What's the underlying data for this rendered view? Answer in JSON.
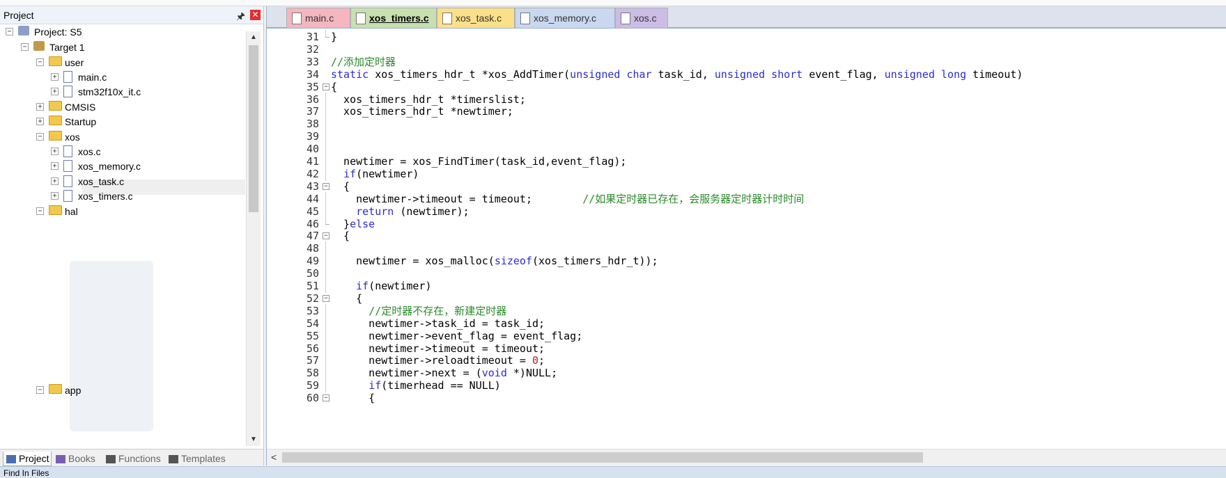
{
  "project_panel": {
    "title": "Project",
    "pin_icon": "pin-icon",
    "close_glyph": "✕",
    "tree": [
      {
        "label": "Project: S5",
        "icon": "project-icon",
        "expander": "−",
        "level": 0
      },
      {
        "label": "Target 1",
        "icon": "target-icon",
        "expander": "−",
        "level": 1
      },
      {
        "label": "user",
        "icon": "folder-icon",
        "expander": "−",
        "level": 2
      },
      {
        "label": "main.c",
        "icon": "file-icon",
        "expander": "+",
        "level": 3
      },
      {
        "label": "stm32f10x_it.c",
        "icon": "file-icon",
        "expander": "+",
        "level": 3
      },
      {
        "label": "CMSIS",
        "icon": "folder-icon",
        "expander": "+",
        "level": 2
      },
      {
        "label": "Startup",
        "icon": "folder-icon",
        "expander": "+",
        "level": 2
      },
      {
        "label": "xos",
        "icon": "folder-icon",
        "expander": "−",
        "level": 2
      },
      {
        "label": "xos.c",
        "icon": "file-icon",
        "expander": "+",
        "level": 3,
        "selected": true
      },
      {
        "label": "xos_memory.c",
        "icon": "file-icon",
        "expander": "+",
        "level": 3
      },
      {
        "label": "xos_task.c",
        "icon": "file-icon",
        "expander": "+",
        "level": 3
      },
      {
        "label": "xos_timers.c",
        "icon": "file-icon",
        "expander": "+",
        "level": 3
      },
      {
        "label": "hal",
        "icon": "folder-icon",
        "expander": "−",
        "level": 2
      },
      {
        "label": "app",
        "icon": "folder-icon",
        "expander": "−",
        "level": 2
      }
    ],
    "bottom_tabs": [
      {
        "label": "Project",
        "icon": "project-tab-icon",
        "active": true
      },
      {
        "label": "Books",
        "icon": "books-icon",
        "active": false
      },
      {
        "label": "Functions",
        "icon": "functions-icon",
        "active": false
      },
      {
        "label": "Templates",
        "icon": "templates-icon",
        "active": false
      }
    ]
  },
  "editor": {
    "tabs": [
      {
        "label": "main.c",
        "color": "#f4b6bf",
        "active": false
      },
      {
        "label": "xos_timers.c",
        "color": "#c8e0b0",
        "active": true
      },
      {
        "label": "xos_task.c",
        "color": "#fbe08a",
        "active": false
      },
      {
        "label": "xos_memory.c",
        "color": "#c9d8f0",
        "active": false
      },
      {
        "label": "xos.c",
        "color": "#cbbde6",
        "active": false
      }
    ],
    "lines": [
      {
        "n": "31",
        "fold": "end",
        "segs": [
          [
            "}",
            ""
          ]
        ]
      },
      {
        "n": "32",
        "fold": "",
        "segs": []
      },
      {
        "n": "33",
        "fold": "",
        "segs": [
          [
            "//添加定时器",
            "cm"
          ]
        ]
      },
      {
        "n": "34",
        "fold": "",
        "segs": [
          [
            "static",
            "kw"
          ],
          [
            " xos_timers_hdr_t *xos_AddTimer(",
            ""
          ],
          [
            "unsigned char",
            "kw"
          ],
          [
            " task_id, ",
            ""
          ],
          [
            "unsigned short",
            "kw"
          ],
          [
            " event_flag, ",
            ""
          ],
          [
            "unsigned long",
            "kw"
          ],
          [
            " timeout)",
            ""
          ]
        ]
      },
      {
        "n": "35",
        "fold": "open",
        "segs": [
          [
            "{",
            ""
          ]
        ]
      },
      {
        "n": "36",
        "fold": "line",
        "segs": [
          [
            "  xos_timers_hdr_t *timerslist;",
            ""
          ]
        ]
      },
      {
        "n": "37",
        "fold": "line",
        "segs": [
          [
            "  xos_timers_hdr_t *newtimer;",
            ""
          ]
        ]
      },
      {
        "n": "38",
        "fold": "line",
        "segs": []
      },
      {
        "n": "39",
        "fold": "line",
        "segs": []
      },
      {
        "n": "40",
        "fold": "line",
        "segs": []
      },
      {
        "n": "41",
        "fold": "line",
        "segs": [
          [
            "  newtimer = xos_FindTimer(task_id,event_flag);",
            ""
          ]
        ]
      },
      {
        "n": "42",
        "fold": "line",
        "segs": [
          [
            "  ",
            ""
          ],
          [
            "if",
            "kw"
          ],
          [
            "(newtimer)",
            ""
          ]
        ]
      },
      {
        "n": "43",
        "fold": "open",
        "segs": [
          [
            "  {",
            ""
          ]
        ]
      },
      {
        "n": "44",
        "fold": "line",
        "segs": [
          [
            "    newtimer->timeout = timeout;        ",
            ""
          ],
          [
            "//如果定时器已存在，会服务器定时器计时时间",
            "cm"
          ]
        ]
      },
      {
        "n": "45",
        "fold": "line",
        "segs": [
          [
            "    ",
            ""
          ],
          [
            "return",
            "kw"
          ],
          [
            " (newtimer);",
            ""
          ]
        ]
      },
      {
        "n": "46",
        "fold": "end",
        "segs": [
          [
            "  }",
            ""
          ],
          [
            "else",
            "kw"
          ]
        ]
      },
      {
        "n": "47",
        "fold": "open",
        "segs": [
          [
            "  {",
            ""
          ]
        ]
      },
      {
        "n": "48",
        "fold": "line",
        "segs": []
      },
      {
        "n": "49",
        "fold": "line",
        "segs": [
          [
            "    newtimer = xos_malloc(",
            ""
          ],
          [
            "sizeof",
            "kw"
          ],
          [
            "(xos_timers_hdr_t));",
            ""
          ]
        ]
      },
      {
        "n": "50",
        "fold": "line",
        "segs": []
      },
      {
        "n": "51",
        "fold": "line",
        "segs": [
          [
            "    ",
            ""
          ],
          [
            "if",
            "kw"
          ],
          [
            "(newtimer)",
            ""
          ]
        ]
      },
      {
        "n": "52",
        "fold": "open",
        "segs": [
          [
            "    {",
            ""
          ]
        ]
      },
      {
        "n": "53",
        "fold": "line",
        "segs": [
          [
            "      ",
            ""
          ],
          [
            "//定时器不存在，新建定时器",
            "cm"
          ]
        ]
      },
      {
        "n": "54",
        "fold": "line",
        "segs": [
          [
            "      newtimer->task_id = task_id;",
            ""
          ]
        ]
      },
      {
        "n": "55",
        "fold": "line",
        "segs": [
          [
            "      newtimer->event_flag = event_flag;",
            ""
          ]
        ]
      },
      {
        "n": "56",
        "fold": "line",
        "segs": [
          [
            "      newtimer->timeout = timeout;",
            ""
          ]
        ]
      },
      {
        "n": "57",
        "fold": "line",
        "segs": [
          [
            "      newtimer->reloadtimeout = ",
            ""
          ],
          [
            "0",
            "num"
          ],
          [
            ";",
            ""
          ]
        ]
      },
      {
        "n": "58",
        "fold": "line",
        "segs": [
          [
            "      newtimer->next = (",
            ""
          ],
          [
            "void",
            "kw"
          ],
          [
            " *)NULL;",
            ""
          ]
        ]
      },
      {
        "n": "59",
        "fold": "line",
        "segs": [
          [
            "      ",
            ""
          ],
          [
            "if",
            "kw"
          ],
          [
            "(timerhead == NULL)",
            ""
          ]
        ]
      },
      {
        "n": "60",
        "fold": "open",
        "segs": [
          [
            "      {",
            ""
          ]
        ]
      }
    ]
  },
  "status_bar": {
    "text": "Find In Files"
  }
}
